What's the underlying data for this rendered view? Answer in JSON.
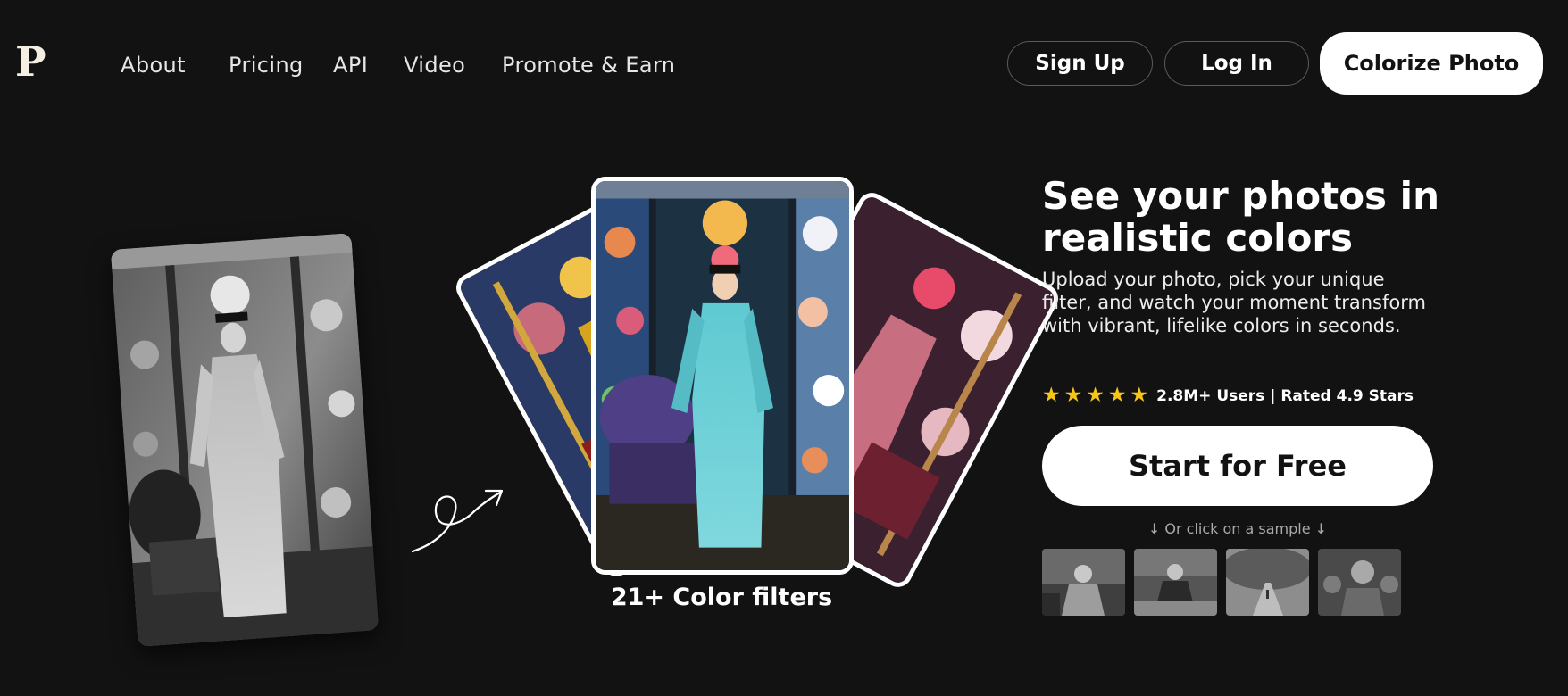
{
  "header": {
    "logo": "P",
    "nav": [
      "About",
      "Pricing",
      "API",
      "Video",
      "Promote & Earn"
    ],
    "signup_label": "Sign Up",
    "login_label": "Log In",
    "cta_label": "Colorize Photo"
  },
  "hero": {
    "caption": "21+ Color filters",
    "headline": "See your photos in realistic colors",
    "subtext": "Upload your photo, pick your unique filter, and watch your moment transform with vibrant, lifelike colors in seconds.",
    "stars": 5,
    "rating_text": "2.8M+ Users | Rated 4.9 Stars",
    "start_label": "Start for Free",
    "sample_hint": "↓ Or click on a sample ↓"
  },
  "icons": {
    "star": "star-icon",
    "arrow": "curly-arrow-icon"
  },
  "colors": {
    "background": "#131213",
    "accent_star": "#f5c518",
    "button_fill": "#ffffff"
  }
}
